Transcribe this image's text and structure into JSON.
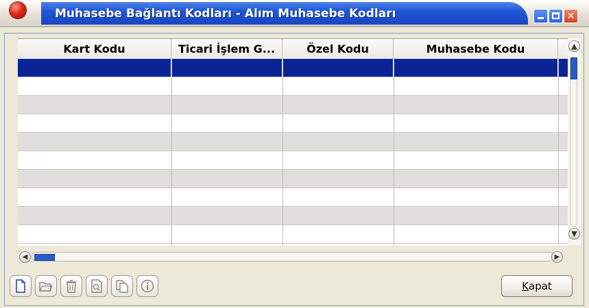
{
  "window": {
    "title": "Muhasebe Bağlantı Kodları - Alım Muhasebe Kodları"
  },
  "grid": {
    "columns": [
      "Kart Kodu",
      "Ticari İşlem G...",
      "Özel Kodu",
      "Muhasebe Kodu"
    ],
    "rows": [
      [
        "",
        "",
        "",
        ""
      ],
      [
        "",
        "",
        "",
        ""
      ],
      [
        "",
        "",
        "",
        ""
      ],
      [
        "",
        "",
        "",
        ""
      ],
      [
        "",
        "",
        "",
        ""
      ],
      [
        "",
        "",
        "",
        ""
      ],
      [
        "",
        "",
        "",
        ""
      ],
      [
        "",
        "",
        "",
        ""
      ],
      [
        "",
        "",
        "",
        ""
      ],
      [
        "",
        "",
        "",
        ""
      ]
    ],
    "selected_row": 0
  },
  "toolbar": {
    "buttons": [
      "new-icon",
      "open-icon",
      "delete-icon",
      "preview-icon",
      "copy-icon",
      "info-icon"
    ]
  },
  "actions": {
    "kapat_label_prefix": "K",
    "kapat_label_rest": "apat"
  },
  "colors": {
    "title_blue": "#2057d6",
    "selection": "#0a2496"
  }
}
